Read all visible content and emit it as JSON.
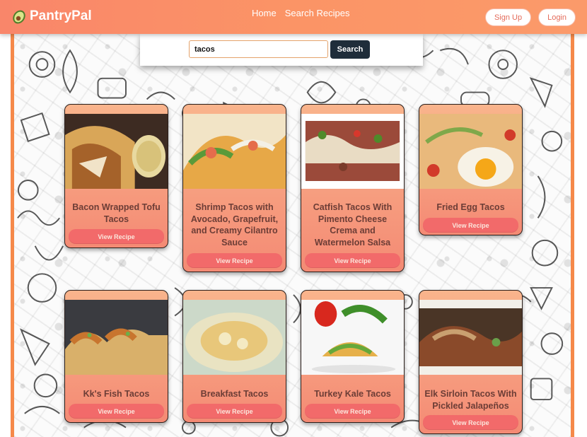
{
  "header": {
    "brand": "PantryPal",
    "nav": [
      "Home",
      "Search Recipes"
    ],
    "auth": {
      "signup": "Sign Up",
      "login": "Login"
    },
    "accent": "#f9866a"
  },
  "search": {
    "value": "tacos",
    "button": "Search"
  },
  "recipes": [
    {
      "title": "Bacon Wrapped Tofu Tacos",
      "button": "View Recipe"
    },
    {
      "title": "Shrimp Tacos with Avocado, Grapefruit, and Creamy Cilantro Sauce",
      "button": "View Recipe"
    },
    {
      "title": "Catfish Tacos With Pimento Cheese Crema and Watermelon Salsa",
      "button": "View Recipe"
    },
    {
      "title": "Fried Egg Tacos",
      "button": "View Recipe"
    },
    {
      "title": "Kk's Fish Tacos",
      "button": "View Recipe"
    },
    {
      "title": "Breakfast Tacos",
      "button": "View Recipe"
    },
    {
      "title": "Turkey Kale Tacos",
      "button": "View Recipe"
    },
    {
      "title": "Elk Sirloin Tacos With Pickled Jalapeños",
      "button": "View Recipe"
    }
  ]
}
